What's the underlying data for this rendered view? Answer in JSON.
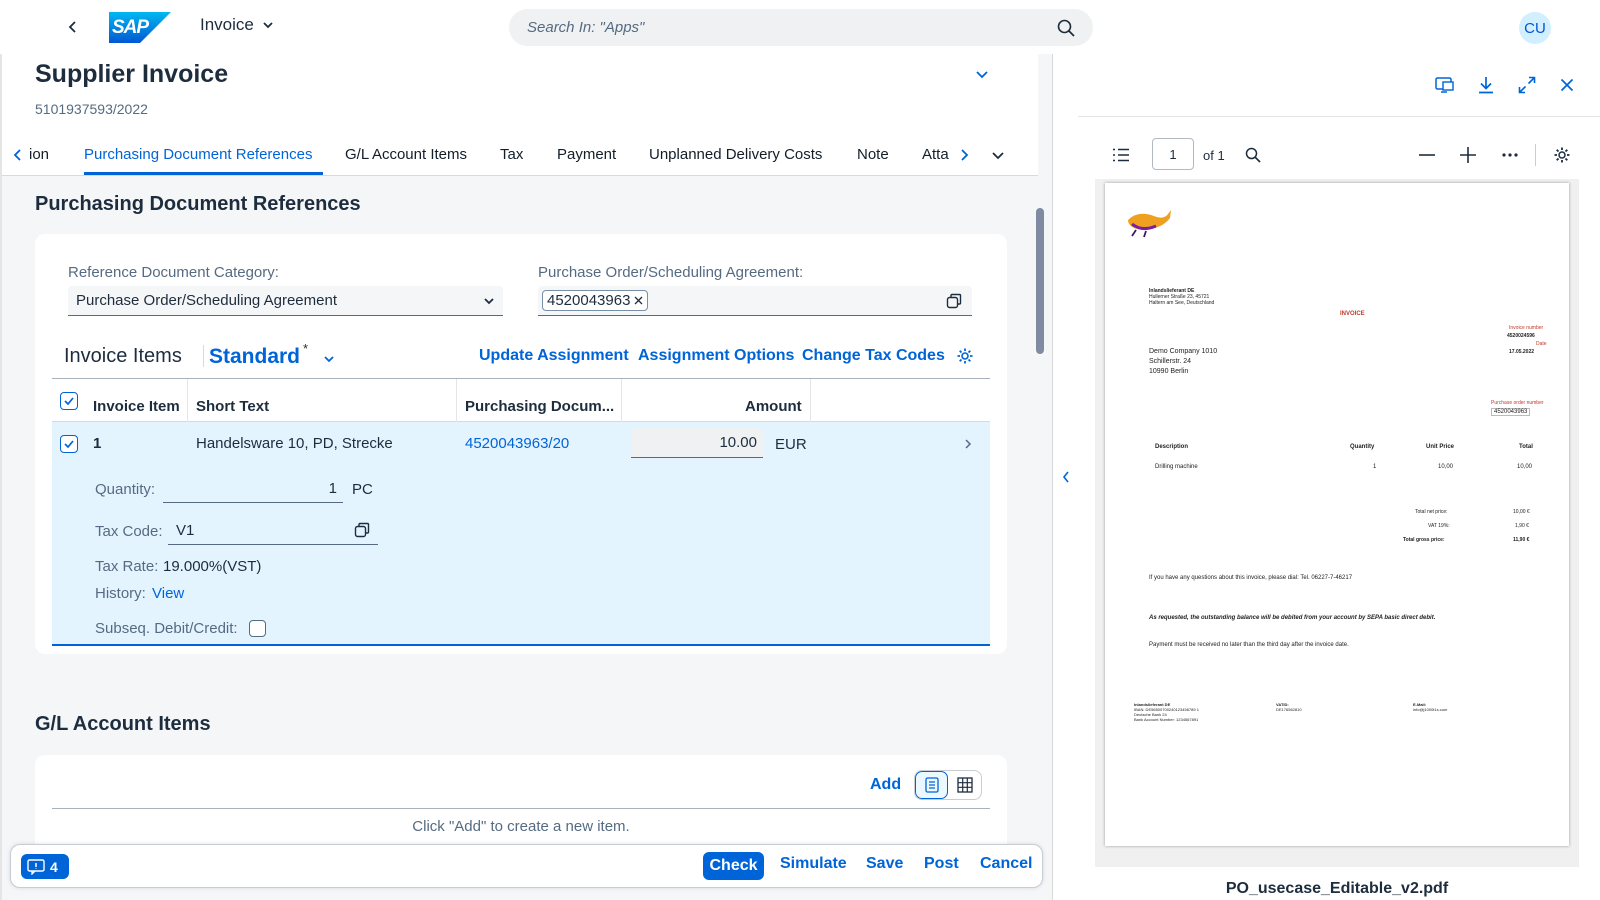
{
  "shell": {
    "app_title": "Invoice",
    "search_placeholder": "Search In: \"Apps\"",
    "avatar_initials": "CU",
    "logo_text": "SAP",
    "accent": "#0064d9"
  },
  "header": {
    "title": "Supplier Invoice",
    "subtitle": "5101937593/2022"
  },
  "tabs": [
    {
      "label": "ion",
      "selected": false
    },
    {
      "label": "Purchasing Document References",
      "selected": true
    },
    {
      "label": "G/L Account Items",
      "selected": false
    },
    {
      "label": "Tax",
      "selected": false
    },
    {
      "label": "Payment",
      "selected": false
    },
    {
      "label": "Unplanned Delivery Costs",
      "selected": false
    },
    {
      "label": "Note",
      "selected": false
    },
    {
      "label": "Atta",
      "selected": false
    }
  ],
  "pdr": {
    "section_title": "Purchasing Document References",
    "ref_category_label": "Reference Document Category:",
    "ref_category_value": "Purchase Order/Scheduling Agreement",
    "po_label": "Purchase Order/Scheduling Agreement:",
    "po_token": "4520043963"
  },
  "invoice_items": {
    "title": "Invoice Items",
    "variant": "Standard",
    "variant_modified": "*",
    "actions": {
      "update_assignment": "Update Assignment",
      "assignment_options": "Assignment Options",
      "change_tax_codes": "Change Tax Codes"
    },
    "columns": [
      "Invoice Item",
      "Short Text",
      "Purchasing Docum...",
      "Amount"
    ],
    "rows": [
      {
        "item": "1",
        "short_text": "Handelsware 10, PD, Strecke",
        "purchasing_doc": "4520043963/20",
        "amount": "10.00",
        "currency": "EUR",
        "selected": true
      }
    ],
    "details": {
      "quantity_label": "Quantity:",
      "quantity_value": "1",
      "quantity_unit": "PC",
      "tax_code_label": "Tax Code:",
      "tax_code_value": "V1",
      "tax_rate_label": "Tax Rate:",
      "tax_rate_value": "19.000%(VST)",
      "history_label": "History:",
      "history_link": "View",
      "subseq_label": "Subseq. Debit/Credit:",
      "subseq_checked": false
    }
  },
  "gl": {
    "section_title": "G/L Account Items",
    "add_label": "Add",
    "empty_text": "Click \"Add\" to create a new item."
  },
  "footer": {
    "messages_count": "4",
    "check": "Check",
    "simulate": "Simulate",
    "save": "Save",
    "post": "Post",
    "cancel": "Cancel"
  },
  "pdf": {
    "page_input": "1",
    "page_of": "of 1",
    "filename": "PO_usecase_Editable_v2.pdf",
    "doc": {
      "sender_name": "Inlandslieferant DE",
      "sender_line1": "Hullerner Straße 23, 45721",
      "sender_line2": "Haltern am See, Deutschland",
      "heading": "INVOICE",
      "invoice_number_label": "Invoice number",
      "invoice_number": "4520024596",
      "date_label": "Date",
      "date": "17.05.2022",
      "recipient_1": "Demo Company 1010",
      "recipient_2": "Schillerstr. 24",
      "recipient_3": "10990 Berlin",
      "po_number_label": "Purchase order number",
      "po_number": "4520043963",
      "col_description": "Description",
      "col_quantity": "Quantity",
      "col_unit_price": "Unit Price",
      "col_total": "Total",
      "line_description": "Drilling machine",
      "line_quantity": "1",
      "line_unit_price": "10,00",
      "line_total": "10,00",
      "total_net_label": "Total net price:",
      "total_net": "10,00 €",
      "vat_label": "VAT 19%:",
      "vat": "1,90 €",
      "total_gross_label": "Total gross price:",
      "total_gross": "11,90 €",
      "questions": "If you have any questions about this invoice, please dial: Tel. 06227-7-46217",
      "sepa_note": "As requested, the outstanding balance will be debited from your account by SEPA basic direct debit.",
      "payment_note": "Payment must be received no later than the third day after the invoice date.",
      "footer_col1_1": "Inlandslieferant DE",
      "footer_col1_2": "IBAN: DE56500700240123456789 1",
      "footer_col1_3": "Deutsche Bank 24",
      "footer_col1_4": "Bank Account Number: 1234567891",
      "footer_col2_1": "VATID:",
      "footer_col2_2": "DE176562810",
      "footer_col3_1": "E-Mail:",
      "footer_col3_2": "info@j1000t1s.com"
    }
  }
}
